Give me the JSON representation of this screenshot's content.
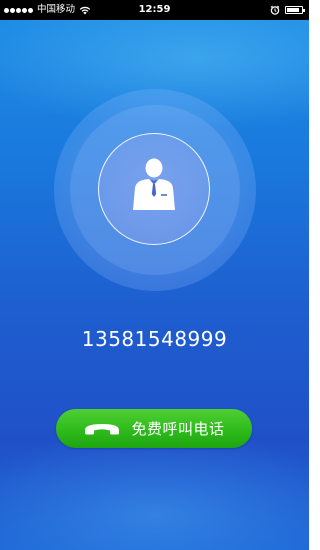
{
  "status_bar": {
    "carrier": "中国移动",
    "time": "12:59",
    "signal_dots": 5,
    "icons": [
      "wifi-icon",
      "alarm-icon",
      "battery-icon"
    ],
    "battery_level": 0.85
  },
  "contact": {
    "avatar_icon": "person-icon",
    "phone_number": "13581548999"
  },
  "call_button": {
    "label": "免费呼叫电话",
    "icon": "handset-icon",
    "color": "#2cb81a"
  },
  "colors": {
    "background_top": "#1d8ee6",
    "background_bottom": "#2050c8"
  }
}
